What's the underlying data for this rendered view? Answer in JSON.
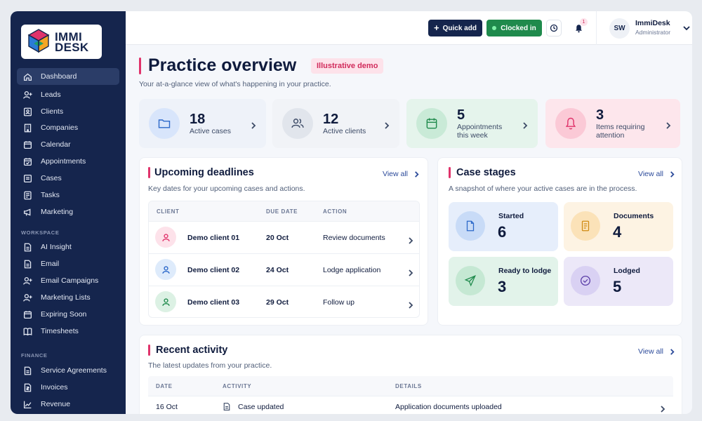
{
  "app": {
    "logo_line1": "IMMI",
    "logo_line2": "DESK"
  },
  "sidebar": {
    "items": [
      {
        "label": "Dashboard",
        "icon": "home-icon"
      },
      {
        "label": "Leads",
        "icon": "user-plus-icon"
      },
      {
        "label": "Clients",
        "icon": "contact-card-icon"
      },
      {
        "label": "Companies",
        "icon": "building-icon"
      },
      {
        "label": "Calendar",
        "icon": "calendar-icon"
      },
      {
        "label": "Appointments",
        "icon": "calendar-check-icon"
      },
      {
        "label": "Cases",
        "icon": "briefcase-icon"
      },
      {
        "label": "Tasks",
        "icon": "checklist-icon"
      },
      {
        "label": "Marketing",
        "icon": "megaphone-icon"
      }
    ],
    "workspace_label": "WORKSPACE",
    "workspace_items": [
      {
        "label": "AI Insight",
        "icon": "document-icon"
      },
      {
        "label": "Email",
        "icon": "document-icon"
      },
      {
        "label": "Email Campaigns",
        "icon": "user-plus-icon"
      },
      {
        "label": "Marketing Lists",
        "icon": "user-plus-icon"
      },
      {
        "label": "Expiring Soon",
        "icon": "calendar-icon"
      },
      {
        "label": "Timesheets",
        "icon": "book-icon"
      }
    ],
    "finance_label": "FINANCE",
    "finance_items": [
      {
        "label": "Service Agreements",
        "icon": "document-icon"
      },
      {
        "label": "Invoices",
        "icon": "invoice-icon"
      },
      {
        "label": "Revenue",
        "icon": "chart-line-icon"
      }
    ]
  },
  "topbar": {
    "quick_add": "Quick add",
    "clocked_in": "Clocked in",
    "notification_count": "1",
    "user_initials": "SW",
    "user_name": "ImmiDesk",
    "user_role": "Administrator"
  },
  "page": {
    "title": "Practice overview",
    "badge": "Illustrative demo",
    "subtitle": "Your at-a-glance view of what's happening in your practice."
  },
  "stats": [
    {
      "number": "18",
      "label_line1": "Active cases",
      "label_line2": ""
    },
    {
      "number": "12",
      "label_line1": "Active clients",
      "label_line2": ""
    },
    {
      "number": "5",
      "label_line1": "Appointments",
      "label_line2": "this week"
    },
    {
      "number": "3",
      "label_line1": "Items requiring",
      "label_line2": "attention"
    }
  ],
  "deadlines": {
    "title": "Upcoming deadlines",
    "view_all": "View all",
    "subtitle": "Key dates for your upcoming cases and actions.",
    "col_client": "CLIENT",
    "col_due": "DUE DATE",
    "col_action": "ACTION",
    "rows": [
      {
        "client": "Demo client 01",
        "due": "20 Oct",
        "action": "Review documents"
      },
      {
        "client": "Demo client 02",
        "due": "24 Oct",
        "action": "Lodge application"
      },
      {
        "client": "Demo client 03",
        "due": "29 Oct",
        "action": "Follow up"
      }
    ]
  },
  "stages": {
    "title": "Case stages",
    "view_all": "View all",
    "subtitle": "A snapshot of where your active cases are in the process.",
    "items": [
      {
        "label": "Started",
        "count": "6"
      },
      {
        "label": "Documents",
        "count": "4"
      },
      {
        "label": "Ready to lodge",
        "count": "3"
      },
      {
        "label": "Lodged",
        "count": "5"
      }
    ]
  },
  "activity": {
    "title": "Recent activity",
    "view_all": "View all",
    "subtitle": "The latest updates from your practice.",
    "col_date": "DATE",
    "col_activity": "ACTIVITY",
    "col_details": "DETAILS",
    "rows": [
      {
        "date": "16 Oct",
        "activity": "Case updated",
        "details": "Application documents uploaded"
      }
    ]
  },
  "colors": {
    "sidebar": "#15254d",
    "accent_pink": "#e0336b",
    "quick_add": "#15254d",
    "clocked_in": "#1f8a4c"
  }
}
